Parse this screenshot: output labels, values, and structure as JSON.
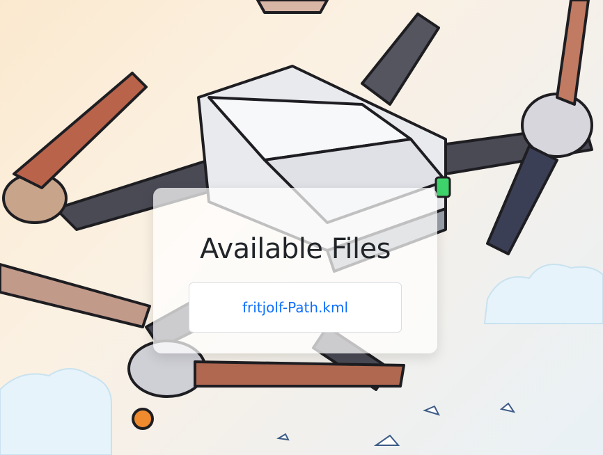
{
  "page": {
    "heading": "Available Files"
  },
  "files": [
    {
      "name": "fritjolf-Path.kml"
    }
  ],
  "colors": {
    "link": "#0d6efd",
    "heading": "#212529",
    "card_background": "rgba(255,255,255,0.72)"
  },
  "background": {
    "description_icon": "drone-illustration"
  }
}
